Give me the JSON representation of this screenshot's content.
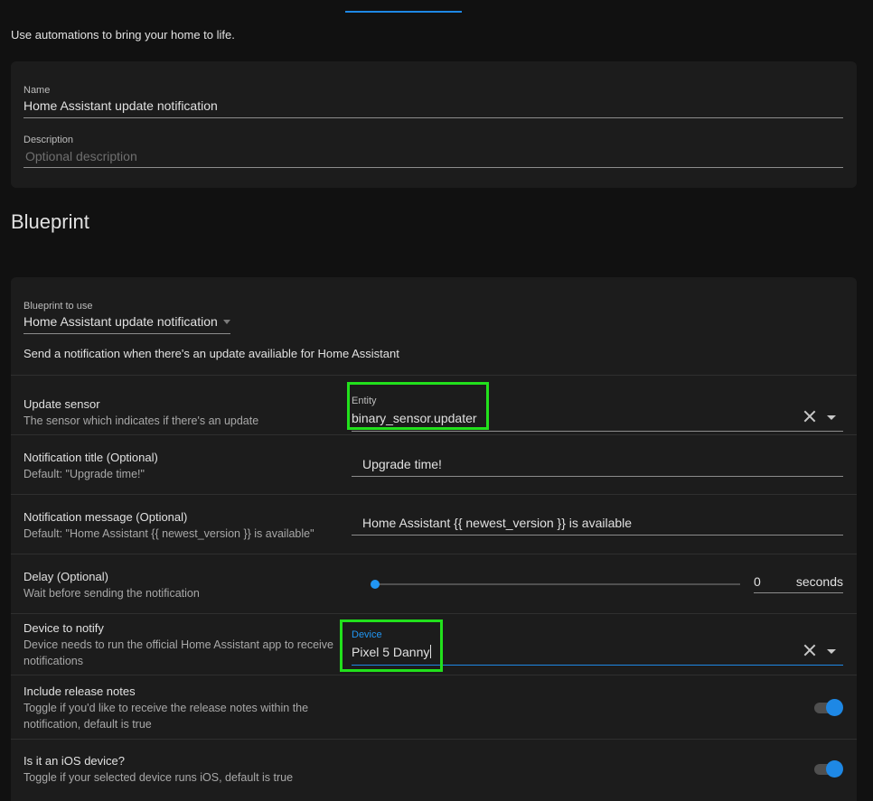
{
  "page": {
    "subtitle": "Use automations to bring your home to life."
  },
  "details": {
    "name_label": "Name",
    "name_value": "Home Assistant update notification",
    "description_label": "Description",
    "description_placeholder": "Optional description"
  },
  "blueprint": {
    "section_title": "Blueprint",
    "select_label": "Blueprint to use",
    "select_value": "Home Assistant update notification",
    "description": "Send a notification when there's an update availiable for Home Assistant",
    "inputs": {
      "update_sensor": {
        "title": "Update sensor",
        "description": "The sensor which indicates if there's an update",
        "field_label": "Entity",
        "value": "binary_sensor.updater"
      },
      "notification_title": {
        "title": "Notification title (Optional)",
        "description": "Default: \"Upgrade time!\"",
        "value": "Upgrade time!"
      },
      "notification_message": {
        "title": "Notification message (Optional)",
        "description": "Default: \"Home Assistant {{ newest_version }} is available\"",
        "value": "Home Assistant {{ newest_version }} is available"
      },
      "delay": {
        "title": "Delay (Optional)",
        "description": "Wait before sending the notification",
        "value": "0",
        "unit": "seconds",
        "slider_fraction": 0
      },
      "device": {
        "title": "Device to notify",
        "description": "Device needs to run the official Home Assistant app to receive notifications",
        "field_label": "Device",
        "value": "Pixel 5 Danny"
      },
      "release_notes": {
        "title": "Include release notes",
        "description": "Toggle if you'd like to receive the release notes within the notification, default is true",
        "enabled": true
      },
      "ios_device": {
        "title": "Is it an iOS device?",
        "description": "Toggle if your selected device runs iOS, default is true",
        "enabled": true
      }
    }
  },
  "colors": {
    "accent": "#1e88e5",
    "highlight": "#22e01c",
    "background": "#111111",
    "card": "#1c1c1c"
  },
  "icons": {
    "clear": "close-icon",
    "dropdown": "chevron-down-icon"
  }
}
